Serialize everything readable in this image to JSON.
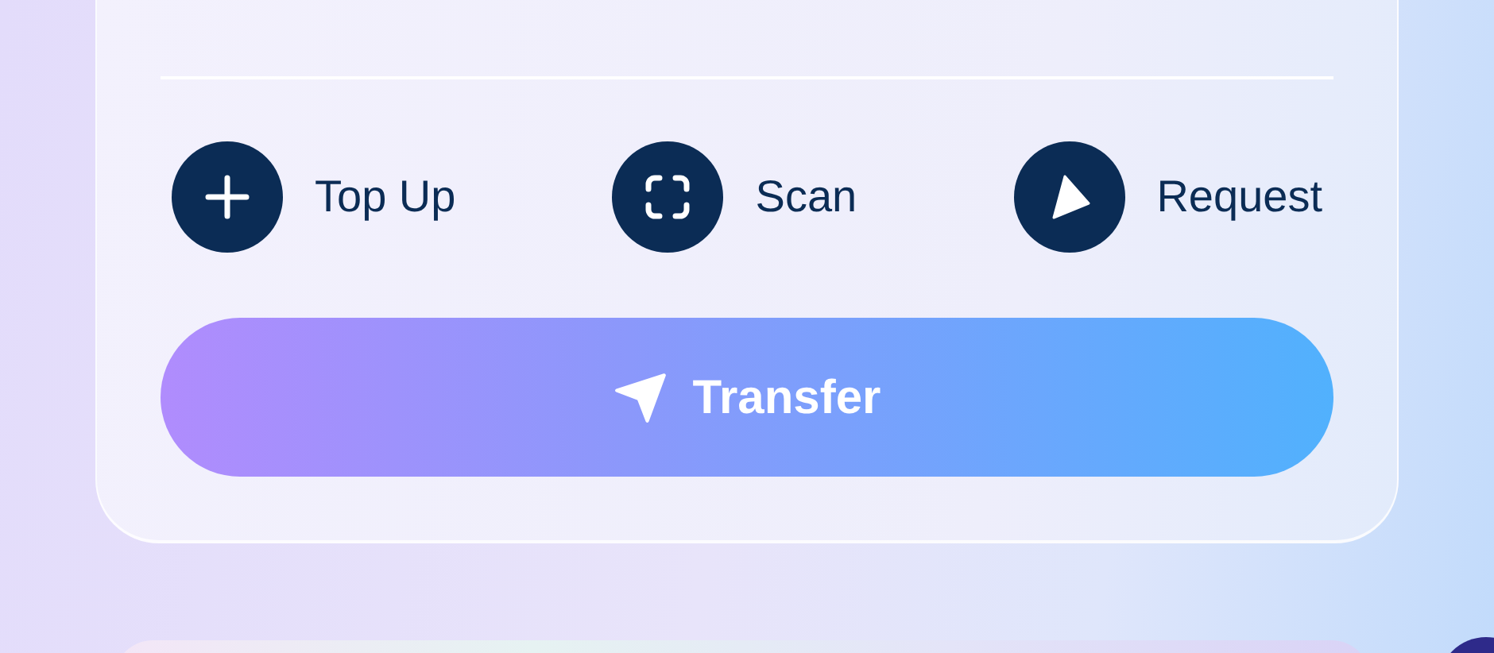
{
  "actions": [
    {
      "kind": "plus",
      "label": "Top Up"
    },
    {
      "kind": "scan",
      "label": "Scan"
    },
    {
      "kind": "request",
      "label": "Request"
    }
  ],
  "transfer_button": {
    "label": "Transfer"
  }
}
